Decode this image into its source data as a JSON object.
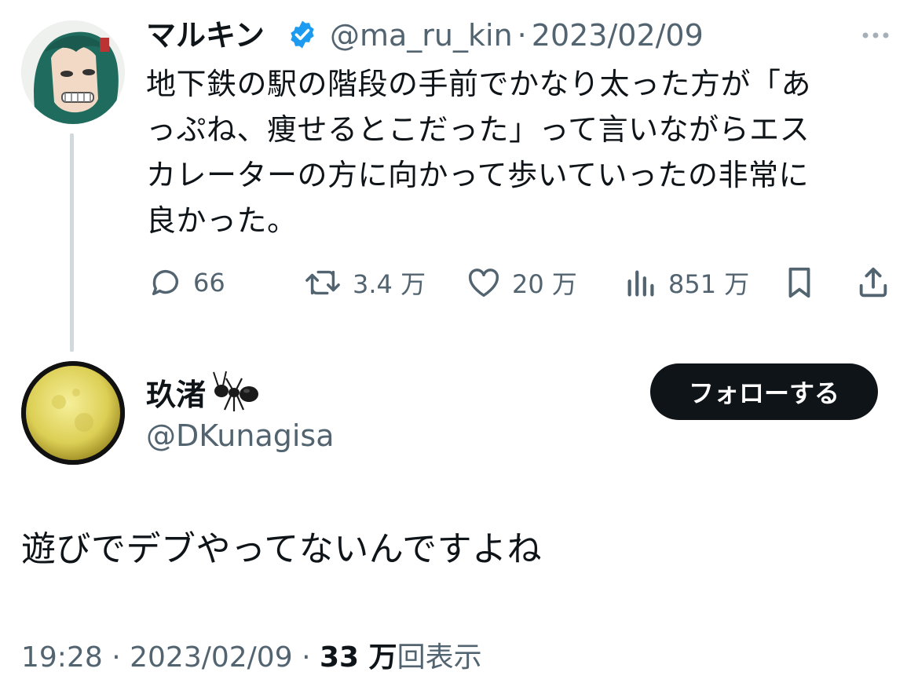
{
  "original_tweet": {
    "author_name": "マルキン",
    "handle": "@ma_ru_kin",
    "separator": "·",
    "date": "2023/02/09",
    "text_lines": [
      "地下鉄の駅の階段の手前でかなり太った方が「あ",
      "っぷね、痩せるとこだった」って言いながらエス",
      "カレーターの方に向かって歩いていったの非常に",
      "良かった。"
    ],
    "actions": {
      "replies": "66",
      "reposts": "3.4 万",
      "likes": "20 万",
      "views": "851 万"
    },
    "icons": [
      "verified-badge-icon",
      "more-icon",
      "reply-icon",
      "repost-icon",
      "like-icon",
      "views-icon",
      "bookmark-icon",
      "share-icon"
    ]
  },
  "reply_tweet": {
    "author_name": "玖渚",
    "name_emoji": "ant-emoji",
    "handle": "@DKunagisa",
    "follow_label": "フォローする",
    "text": "遊びでデブやってないんですよね",
    "time": "19:28",
    "separator": "·",
    "date": "2023/02/09",
    "views_count": "33 万",
    "views_label": "回表示"
  },
  "colors": {
    "text_primary": "#0f1419",
    "text_secondary": "#536471",
    "verified_blue": "#1d9bf0",
    "thread_line": "#cfd9de",
    "button_dark": "#0f1419"
  }
}
